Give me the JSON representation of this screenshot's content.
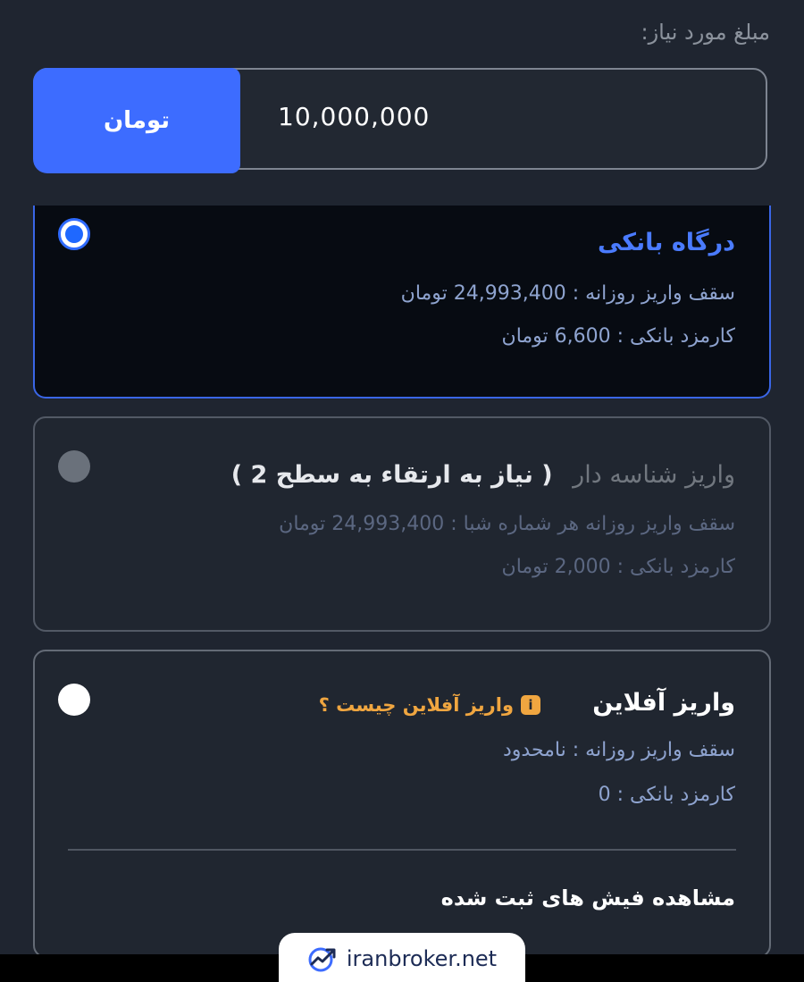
{
  "amount": {
    "label": "مبلغ مورد نیاز:",
    "value": "10,000,000",
    "currency_button": "تومان"
  },
  "options": [
    {
      "title": "درگاه بانکی",
      "limit": "سقف واریز روزانه : 24,993,400 تومان",
      "fee": "کارمزد بانکی : 6,600 تومان",
      "selected": true
    },
    {
      "title": "واریز شناسه دار",
      "title_note": "( نیاز به ارتقاء به سطح 2 )",
      "limit": "سقف واریز روزانه هر شماره شبا : 24,993,400 تومان",
      "fee": "کارمزد بانکی : 2,000 تومان",
      "selected": false
    },
    {
      "title": "واریز آفلاین",
      "help_link": "واریز آفلاین چیست ؟",
      "limit": "سقف واریز روزانه : نامحدود",
      "fee": "کارمزد بانکی : 0",
      "receipts_link": "مشاهده فیش های ثبت شده",
      "selected": false
    }
  ],
  "watermark": {
    "text": "iranbroker.net"
  },
  "colors": {
    "background": "#1f2530",
    "accent": "#3d6cff",
    "selected_title": "#4a7bff",
    "detail_text": "#8ea3cf",
    "warning": "#f0a640"
  }
}
